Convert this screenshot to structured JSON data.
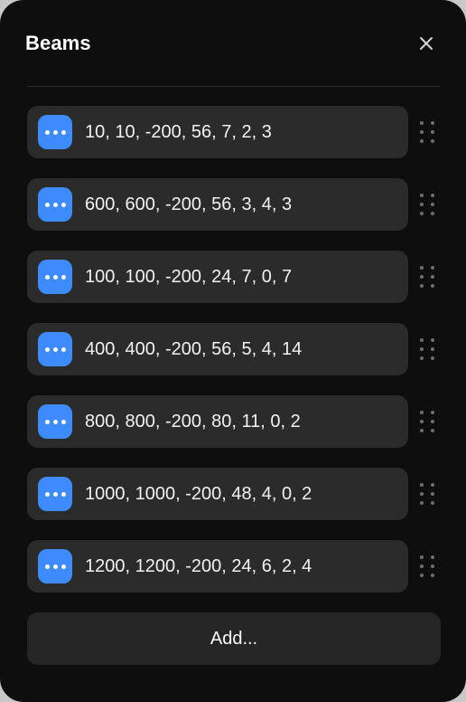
{
  "panel": {
    "title": "Beams",
    "close_icon": "close-icon",
    "accent_color": "#3d8bfd",
    "background_color": "#0e0e0e",
    "row_background_color": "#2b2b2b"
  },
  "rows": [
    {
      "label": "10, 10, -200, 56, 7, 2, 3",
      "menu_icon": "ellipsis-icon",
      "drag_icon": "drag-handle-icon"
    },
    {
      "label": "600, 600, -200, 56, 3, 4, 3",
      "menu_icon": "ellipsis-icon",
      "drag_icon": "drag-handle-icon"
    },
    {
      "label": "100, 100, -200, 24, 7, 0, 7",
      "menu_icon": "ellipsis-icon",
      "drag_icon": "drag-handle-icon"
    },
    {
      "label": "400, 400, -200, 56, 5, 4, 14",
      "menu_icon": "ellipsis-icon",
      "drag_icon": "drag-handle-icon"
    },
    {
      "label": "800, 800, -200, 80, 11, 0, 2",
      "menu_icon": "ellipsis-icon",
      "drag_icon": "drag-handle-icon"
    },
    {
      "label": "1000, 1000, -200, 48, 4, 0, 2",
      "menu_icon": "ellipsis-icon",
      "drag_icon": "drag-handle-icon"
    },
    {
      "label": "1200, 1200, -200, 24, 6, 2, 4",
      "menu_icon": "ellipsis-icon",
      "drag_icon": "drag-handle-icon"
    }
  ],
  "footer": {
    "add_label": "Add..."
  }
}
